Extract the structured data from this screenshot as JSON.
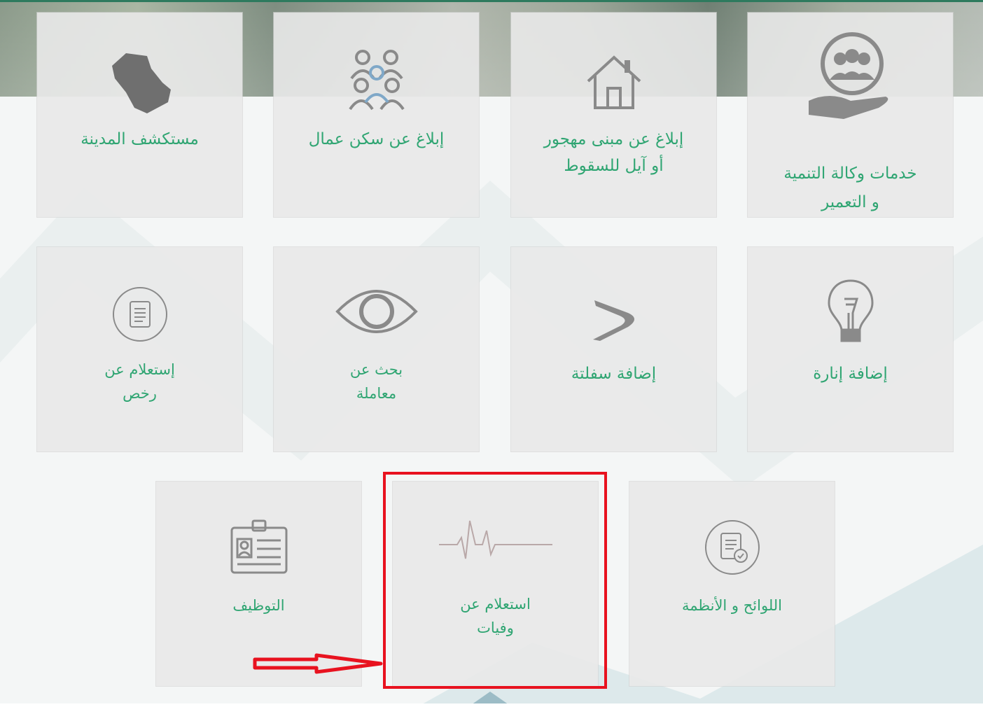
{
  "colors": {
    "accent_green": "#2fa572",
    "highlight_red": "#e8121f",
    "tile_bg": "#e9e9e9"
  },
  "tiles": [
    {
      "icon": "hands-group-icon",
      "line1": "خدمات وكالة التنمية",
      "line2": "و التعمير"
    },
    {
      "icon": "house-icon",
      "line1": "إبلاغ عن مبنى مهجور",
      "line2": "أو آيل للسقوط"
    },
    {
      "icon": "workers-group-icon",
      "line1": "إبلاغ عن سكن عمال",
      "line2": ""
    },
    {
      "icon": "saudi-map-icon",
      "line1": "مستكشف المدينة",
      "line2": ""
    },
    {
      "icon": "light-bulb-icon",
      "line1": "إضافة إنارة",
      "line2": ""
    },
    {
      "icon": "road-icon",
      "line1": "إضافة سفلتة",
      "line2": ""
    },
    {
      "icon": "eye-icon",
      "line1": "بحث عن",
      "line2": "معاملة"
    },
    {
      "icon": "license-document-icon",
      "line1": "إستعلام عن",
      "line2": "رخص"
    },
    {
      "icon": "regulations-document-icon",
      "line1": "اللوائح و الأنظمة",
      "line2": ""
    },
    {
      "icon": "heartbeat-icon",
      "line1": "استعلام عن",
      "line2": "وفيات"
    },
    {
      "icon": "id-badge-icon",
      "line1": "التوظيف",
      "line2": ""
    }
  ]
}
